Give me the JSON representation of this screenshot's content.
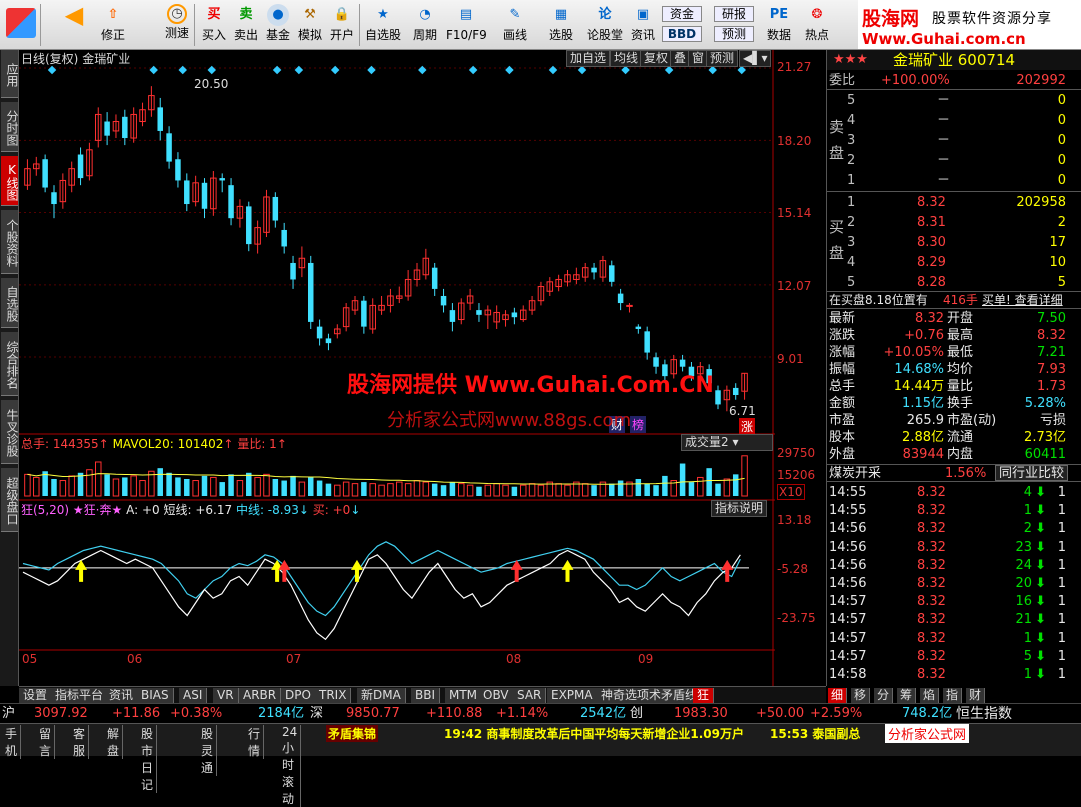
{
  "toolbar": {
    "buttons": [
      {
        "id": "back",
        "label": ""
      },
      {
        "id": "fix",
        "label": "修正"
      },
      {
        "id": "test",
        "label": "测速"
      },
      {
        "id": "buy",
        "label": "买入"
      },
      {
        "id": "sell",
        "label": "卖出"
      },
      {
        "id": "fund",
        "label": "基金"
      },
      {
        "id": "sim",
        "label": "模拟"
      },
      {
        "id": "open",
        "label": "开户"
      },
      {
        "id": "watch",
        "label": "自选股"
      },
      {
        "id": "period",
        "label": "周期"
      },
      {
        "id": "f10",
        "label": "F10/F9"
      },
      {
        "id": "draw",
        "label": "画线"
      },
      {
        "id": "pick",
        "label": "选股"
      },
      {
        "id": "forum",
        "label": "论股堂"
      },
      {
        "id": "news",
        "label": "资讯"
      },
      {
        "id": "funds",
        "label": "资金"
      },
      {
        "id": "bbd",
        "label": "BBD"
      },
      {
        "id": "report",
        "label": "研报"
      },
      {
        "id": "predict",
        "label": "预测"
      },
      {
        "id": "data",
        "label": "数据"
      },
      {
        "id": "hot",
        "label": "热点"
      }
    ],
    "brand_cn": "股海网",
    "brand_sub": "股票软件资源分享",
    "brand_url": "Www.Guhai.com.cn"
  },
  "left_tabs": [
    "应用",
    "分时图",
    "K线图",
    "个股资料",
    "自选股",
    "综合排名",
    "牛叉诊股",
    "超级盘口"
  ],
  "chart_header": {
    "title": "日线(复权)",
    "stock_name": "金瑞矿业",
    "buttons": [
      "加自选",
      "均线",
      "复权",
      "叠",
      "窗",
      "预测"
    ]
  },
  "price_axis": [
    "21.27",
    "18.20",
    "15.14",
    "12.07",
    "9.01"
  ],
  "price_annotations": {
    "high": "20.50",
    "low": "6.71",
    "tag_zhang": "涨",
    "tag_cai": "财",
    "tag_bang": "榜"
  },
  "watermark1": "股海网提供 Www.Guhai.Com.CN",
  "watermark2": "分析家公式网www.88gs.com",
  "volume_header": {
    "total": "总手: 144355",
    "mavol": "MAVOL20: 101402",
    "ratio": "量比: 1",
    "selector": "成交量2"
  },
  "volume_axis": [
    "29750",
    "15206"
  ],
  "volume_unit": "X10",
  "indicator_header": {
    "name": "狂(5,20)",
    "labels": "★狂·奔★",
    "a": "A: +0",
    "short": "短线: +6.17",
    "mid": "中线: -8.93",
    "buy": "买: +0",
    "help": "指标说明"
  },
  "indicator_axis": [
    "13.18",
    "-5.28",
    "-23.75"
  ],
  "months": [
    "05",
    "06",
    "07",
    "08",
    "09"
  ],
  "chart_data": {
    "type": "candlestick",
    "price_range": [
      6.0,
      21.27
    ],
    "candles": [
      {
        "o": 16.3,
        "c": 17.0,
        "h": 17.4,
        "l": 16.1
      },
      {
        "o": 17.0,
        "c": 17.2,
        "h": 17.5,
        "l": 16.7
      },
      {
        "o": 17.4,
        "c": 16.2,
        "h": 17.6,
        "l": 16.0
      },
      {
        "o": 16.0,
        "c": 15.5,
        "h": 16.3,
        "l": 14.9
      },
      {
        "o": 15.6,
        "c": 16.5,
        "h": 16.8,
        "l": 15.3
      },
      {
        "o": 16.3,
        "c": 17.0,
        "h": 17.3,
        "l": 16.0
      },
      {
        "o": 17.6,
        "c": 16.6,
        "h": 17.9,
        "l": 16.3
      },
      {
        "o": 16.7,
        "c": 17.8,
        "h": 18.1,
        "l": 16.5
      },
      {
        "o": 18.2,
        "c": 19.3,
        "h": 19.6,
        "l": 17.9
      },
      {
        "o": 19.0,
        "c": 18.4,
        "h": 19.4,
        "l": 18.0
      },
      {
        "o": 18.6,
        "c": 19.0,
        "h": 19.3,
        "l": 18.3
      },
      {
        "o": 19.2,
        "c": 18.3,
        "h": 19.5,
        "l": 18.0
      },
      {
        "o": 18.3,
        "c": 19.3,
        "h": 19.6,
        "l": 18.1
      },
      {
        "o": 19.0,
        "c": 19.5,
        "h": 19.8,
        "l": 18.8
      },
      {
        "o": 19.5,
        "c": 20.1,
        "h": 20.5,
        "l": 19.2
      },
      {
        "o": 19.6,
        "c": 18.6,
        "h": 20.0,
        "l": 18.2
      },
      {
        "o": 18.5,
        "c": 17.3,
        "h": 18.8,
        "l": 17.0
      },
      {
        "o": 17.4,
        "c": 16.5,
        "h": 17.7,
        "l": 16.2
      },
      {
        "o": 16.5,
        "c": 15.5,
        "h": 16.8,
        "l": 15.2
      },
      {
        "o": 15.6,
        "c": 16.4,
        "h": 16.7,
        "l": 15.4
      },
      {
        "o": 16.4,
        "c": 15.3,
        "h": 16.6,
        "l": 14.9
      },
      {
        "o": 15.3,
        "c": 16.6,
        "h": 16.9,
        "l": 15.0
      },
      {
        "o": 16.6,
        "c": 16.5,
        "h": 16.8,
        "l": 16.0
      },
      {
        "o": 16.3,
        "c": 14.9,
        "h": 16.6,
        "l": 14.6
      },
      {
        "o": 14.9,
        "c": 15.4,
        "h": 15.7,
        "l": 14.5
      },
      {
        "o": 15.4,
        "c": 13.8,
        "h": 15.6,
        "l": 13.5
      },
      {
        "o": 13.8,
        "c": 14.5,
        "h": 14.8,
        "l": 13.4
      },
      {
        "o": 14.3,
        "c": 15.8,
        "h": 16.1,
        "l": 14.1
      },
      {
        "o": 15.8,
        "c": 14.8,
        "h": 16.0,
        "l": 14.5
      },
      {
        "o": 14.4,
        "c": 13.7,
        "h": 14.7,
        "l": 13.4
      },
      {
        "o": 13.0,
        "c": 12.3,
        "h": 13.3,
        "l": 11.9
      },
      {
        "o": 12.8,
        "c": 13.2,
        "h": 13.7,
        "l": 12.4
      },
      {
        "o": 13.0,
        "c": 10.5,
        "h": 13.3,
        "l": 10.2
      },
      {
        "o": 10.3,
        "c": 9.8,
        "h": 10.6,
        "l": 9.5
      },
      {
        "o": 9.8,
        "c": 9.6,
        "h": 10.0,
        "l": 9.3
      },
      {
        "o": 10.0,
        "c": 10.2,
        "h": 10.4,
        "l": 9.8
      },
      {
        "o": 10.3,
        "c": 11.1,
        "h": 11.3,
        "l": 10.1
      },
      {
        "o": 11.0,
        "c": 11.4,
        "h": 11.6,
        "l": 10.8
      },
      {
        "o": 11.4,
        "c": 10.3,
        "h": 11.6,
        "l": 10.0
      },
      {
        "o": 10.2,
        "c": 11.2,
        "h": 11.5,
        "l": 10.0
      },
      {
        "o": 11.0,
        "c": 11.2,
        "h": 11.6,
        "l": 10.8
      },
      {
        "o": 11.2,
        "c": 11.6,
        "h": 11.9,
        "l": 10.9
      },
      {
        "o": 11.5,
        "c": 11.6,
        "h": 12.0,
        "l": 11.3
      },
      {
        "o": 11.6,
        "c": 12.3,
        "h": 12.7,
        "l": 11.4
      },
      {
        "o": 12.3,
        "c": 12.7,
        "h": 13.0,
        "l": 12.0
      },
      {
        "o": 12.5,
        "c": 13.2,
        "h": 13.6,
        "l": 12.3
      },
      {
        "o": 12.8,
        "c": 11.9,
        "h": 13.0,
        "l": 11.6
      },
      {
        "o": 11.6,
        "c": 11.2,
        "h": 11.9,
        "l": 10.9
      },
      {
        "o": 11.0,
        "c": 10.5,
        "h": 11.3,
        "l": 10.1
      },
      {
        "o": 10.6,
        "c": 11.3,
        "h": 11.5,
        "l": 10.4
      },
      {
        "o": 11.3,
        "c": 11.6,
        "h": 11.9,
        "l": 11.0
      },
      {
        "o": 11.0,
        "c": 10.8,
        "h": 11.3,
        "l": 10.5
      },
      {
        "o": 10.8,
        "c": 11.0,
        "h": 11.2,
        "l": 10.2
      },
      {
        "o": 10.5,
        "c": 10.9,
        "h": 11.2,
        "l": 10.2
      },
      {
        "o": 10.6,
        "c": 10.8,
        "h": 11.0,
        "l": 10.3
      },
      {
        "o": 10.9,
        "c": 10.7,
        "h": 11.1,
        "l": 10.4
      },
      {
        "o": 10.6,
        "c": 11.0,
        "h": 11.2,
        "l": 10.5
      },
      {
        "o": 11.0,
        "c": 11.4,
        "h": 11.6,
        "l": 10.8
      },
      {
        "o": 11.4,
        "c": 12.0,
        "h": 12.2,
        "l": 11.2
      },
      {
        "o": 11.8,
        "c": 12.2,
        "h": 12.4,
        "l": 11.6
      },
      {
        "o": 12.0,
        "c": 12.3,
        "h": 12.5,
        "l": 11.8
      },
      {
        "o": 12.2,
        "c": 12.5,
        "h": 12.7,
        "l": 12.0
      },
      {
        "o": 12.3,
        "c": 12.5,
        "h": 12.8,
        "l": 12.1
      },
      {
        "o": 12.4,
        "c": 12.8,
        "h": 13.0,
        "l": 12.2
      },
      {
        "o": 12.8,
        "c": 12.6,
        "h": 13.0,
        "l": 12.3
      },
      {
        "o": 12.4,
        "c": 13.1,
        "h": 13.3,
        "l": 12.2
      },
      {
        "o": 12.9,
        "c": 12.2,
        "h": 13.1,
        "l": 12.0
      },
      {
        "o": 11.7,
        "c": 11.3,
        "h": 11.9,
        "l": 11.0
      },
      {
        "o": 11.2,
        "c": 11.2,
        "h": 11.3,
        "l": 10.9
      },
      {
        "o": 10.3,
        "c": 10.2,
        "h": 10.4,
        "l": 10.0
      },
      {
        "o": 10.1,
        "c": 9.2,
        "h": 10.3,
        "l": 8.9
      },
      {
        "o": 9.0,
        "c": 8.6,
        "h": 9.2,
        "l": 8.3
      },
      {
        "o": 8.7,
        "c": 8.2,
        "h": 8.9,
        "l": 8.0
      },
      {
        "o": 8.3,
        "c": 8.9,
        "h": 9.1,
        "l": 8.1
      },
      {
        "o": 8.9,
        "c": 8.6,
        "h": 9.1,
        "l": 8.4
      },
      {
        "o": 8.6,
        "c": 8.2,
        "h": 8.8,
        "l": 8.0
      },
      {
        "o": 8.3,
        "c": 8.6,
        "h": 8.8,
        "l": 8.1
      },
      {
        "o": 8.5,
        "c": 7.9,
        "h": 8.7,
        "l": 7.6
      },
      {
        "o": 7.6,
        "c": 7.0,
        "h": 7.8,
        "l": 6.8
      },
      {
        "o": 7.2,
        "c": 7.6,
        "h": 7.8,
        "l": 6.71
      },
      {
        "o": 7.7,
        "c": 7.4,
        "h": 7.9,
        "l": 7.2
      },
      {
        "o": 7.56,
        "c": 8.32,
        "h": 8.32,
        "l": 7.2
      }
    ],
    "volume_range": [
      0,
      29750
    ],
    "volumes": [
      14000,
      12000,
      16000,
      11000,
      10000,
      13000,
      15000,
      17000,
      22000,
      14000,
      11000,
      12000,
      13000,
      10000,
      16000,
      18000,
      15000,
      12000,
      11000,
      10000,
      13000,
      12000,
      9000,
      14000,
      10000,
      15000,
      12000,
      14000,
      11000,
      10000,
      13000,
      9000,
      12000,
      10000,
      8000,
      7000,
      9000,
      8000,
      9000,
      8000,
      7000,
      8000,
      9000,
      8000,
      10000,
      9000,
      8000,
      7000,
      9000,
      8000,
      7000,
      6000,
      7000,
      8000,
      7000,
      6000,
      7000,
      8000,
      7000,
      9000,
      8000,
      7000,
      9000,
      8000,
      7000,
      9000,
      8000,
      10000,
      9000,
      11000,
      8000,
      7000,
      13000,
      10000,
      21000,
      9000,
      12000,
      18000,
      8000,
      11000,
      14000,
      26000,
      12000,
      10000,
      16000,
      14000,
      13000
    ],
    "indicator_range": [
      -37,
      23
    ],
    "short_line": [
      -2,
      -4,
      -6,
      -8,
      -6,
      -2,
      2,
      4,
      6,
      8,
      6,
      4,
      2,
      4,
      2,
      0,
      -6,
      -12,
      -18,
      -22,
      -16,
      -10,
      -14,
      -12,
      -6,
      -4,
      -8,
      -2,
      4,
      2,
      -2,
      -8,
      -16,
      -24,
      -30,
      -33,
      -28,
      -20,
      -12,
      -4,
      4,
      6,
      2,
      -4,
      -10,
      -14,
      -8,
      -2,
      2,
      -4,
      -10,
      -14,
      -12,
      -18,
      -16,
      -12,
      -8,
      -6,
      -4,
      -2,
      0,
      2,
      6,
      8,
      6,
      4,
      -2,
      -6,
      -10,
      -16,
      -14,
      -18,
      -20,
      -16,
      -12,
      -16,
      -18,
      -22,
      -16,
      -12,
      -6,
      -2,
      0,
      6
    ],
    "mid_line": [
      2,
      1,
      0,
      -1,
      2,
      4,
      6,
      8,
      9,
      10,
      9,
      8,
      7,
      6,
      5,
      4,
      2,
      -2,
      -6,
      -12,
      -14,
      -10,
      -6,
      -4,
      0,
      2,
      1,
      3,
      6,
      5,
      2,
      -4,
      -10,
      -16,
      -20,
      -22,
      -18,
      -12,
      -6,
      0,
      6,
      10,
      12,
      10,
      6,
      2,
      4,
      6,
      8,
      6,
      4,
      2,
      0,
      -2,
      -1,
      0,
      2,
      3,
      4,
      5,
      6,
      7,
      8,
      9,
      8,
      6,
      4,
      0,
      -4,
      -8,
      -8,
      -10,
      -8,
      -4,
      0,
      -4,
      -6,
      -4,
      -2,
      0,
      2,
      -2,
      -4,
      4
    ],
    "signal_level": 0,
    "arrows_yellow": [
      8,
      35,
      46,
      75
    ],
    "arrows_red": [
      36,
      68,
      97
    ]
  },
  "quote": {
    "name": "金瑞矿业 600714",
    "wb_label": "委比",
    "wb_pct": "+100.00%",
    "wb_diff": "202992",
    "sell_label": "卖盘",
    "buy_label": "买盘",
    "asks": [
      {
        "lv": "5",
        "price": "－",
        "vol": "0"
      },
      {
        "lv": "4",
        "price": "－",
        "vol": "0"
      },
      {
        "lv": "3",
        "price": "－",
        "vol": "0"
      },
      {
        "lv": "2",
        "price": "－",
        "vol": "0"
      },
      {
        "lv": "1",
        "price": "－",
        "vol": "0"
      }
    ],
    "bids": [
      {
        "lv": "1",
        "price": "8.32",
        "vol": "202958"
      },
      {
        "lv": "2",
        "price": "8.31",
        "vol": "2"
      },
      {
        "lv": "3",
        "price": "8.30",
        "vol": "17"
      },
      {
        "lv": "4",
        "price": "8.29",
        "vol": "10"
      },
      {
        "lv": "5",
        "price": "8.28",
        "vol": "5"
      }
    ],
    "position_text": "在买盘8.18位置有",
    "position_vol": "416手",
    "position_link": "买单! 查看详细",
    "stats": [
      {
        "l1": "最新",
        "v1": "8.32",
        "c1": "red",
        "l2": "开盘",
        "v2": "7.50",
        "c2": "grn"
      },
      {
        "l1": "涨跌",
        "v1": "+0.76",
        "c1": "red",
        "l2": "最高",
        "v2": "8.32",
        "c2": "red"
      },
      {
        "l1": "涨幅",
        "v1": "+10.05%",
        "c1": "red",
        "l2": "最低",
        "v2": "7.21",
        "c2": "grn"
      },
      {
        "l1": "振幅",
        "v1": "14.68%",
        "c1": "cy",
        "l2": "均价",
        "v2": "7.93",
        "c2": "red"
      },
      {
        "l1": "总手",
        "v1": "14.44万",
        "c1": "yel",
        "l2": "量比",
        "v2": "1.73",
        "c2": "red"
      },
      {
        "l1": "金额",
        "v1": "1.15亿",
        "c1": "cy",
        "l2": "换手",
        "v2": "5.28%",
        "c2": "cy"
      },
      {
        "l1": "市盈",
        "v1": "265.9",
        "c1": "wht",
        "l2": "市盈(动)",
        "v2": "亏损",
        "c2": "wht"
      },
      {
        "l1": "股本",
        "v1": "2.88亿",
        "c1": "yel",
        "l2": "流通",
        "v2": "2.73亿",
        "c2": "yel"
      },
      {
        "l1": "外盘",
        "v1": "83944",
        "c1": "red",
        "l2": "内盘",
        "v2": "60411",
        "c2": "grn"
      }
    ],
    "industry": "煤炭开采",
    "industry_pct": "1.56%",
    "industry_btn": "同行业比较",
    "ticks": [
      {
        "t": "14:55",
        "p": "8.32",
        "v": "4",
        "d": "down",
        "n": "1"
      },
      {
        "t": "14:55",
        "p": "8.32",
        "v": "1",
        "d": "down",
        "n": "1"
      },
      {
        "t": "14:56",
        "p": "8.32",
        "v": "2",
        "d": "down",
        "n": "1"
      },
      {
        "t": "14:56",
        "p": "8.32",
        "v": "23",
        "d": "down",
        "n": "1"
      },
      {
        "t": "14:56",
        "p": "8.32",
        "v": "24",
        "d": "down",
        "n": "1"
      },
      {
        "t": "14:56",
        "p": "8.32",
        "v": "20",
        "d": "down",
        "n": "1"
      },
      {
        "t": "14:57",
        "p": "8.32",
        "v": "16",
        "d": "down",
        "n": "1"
      },
      {
        "t": "14:57",
        "p": "8.32",
        "v": "21",
        "d": "down",
        "n": "1"
      },
      {
        "t": "14:57",
        "p": "8.32",
        "v": "1",
        "d": "down",
        "n": "1"
      },
      {
        "t": "14:57",
        "p": "8.32",
        "v": "5",
        "d": "down",
        "n": "1"
      },
      {
        "t": "14:58",
        "p": "8.32",
        "v": "1",
        "d": "down",
        "n": "1"
      }
    ],
    "right_tabs": [
      "细",
      "移",
      "分",
      "筹",
      "焰",
      "指",
      "财"
    ]
  },
  "bottom_tabs": [
    "设置",
    "指标平台",
    "资讯",
    "BIAS",
    "ASI",
    "VR",
    "ARBR",
    "DPO",
    "TRIX",
    "新DMA",
    "BBI",
    "MTM",
    "OBV",
    "SAR",
    "EXPMA",
    "神奇选项术矛盾线",
    "狂"
  ],
  "index_bar": {
    "sh_label": "沪",
    "sh_val": "3097.92",
    "sh_chg": "+11.86",
    "sh_pct": "+0.38%",
    "sh_amt": "2184亿",
    "sz_label": "深",
    "sz_val": "9850.77",
    "sz_chg": "+110.88",
    "sz_pct": "+1.14%",
    "sz_amt": "2542亿",
    "cy_label": "创",
    "cy_val": "1983.30",
    "cy_chg": "+50.00",
    "cy_pct": "+2.59%",
    "cy_amt": "748.2亿",
    "hs_label": "恒生指数"
  },
  "status_bar": {
    "items": [
      "手机",
      "留言",
      "客服",
      "解盘",
      "股市日记",
      "股灵通",
      "行情",
      "24小时滚动"
    ],
    "ticker1": "矛盾集锦",
    "news1": "19:42 商事制度改革后中国平均每天新增企业1.09万户",
    "news2": "15:53 泰国副总",
    "corner": "分析家公式网"
  }
}
